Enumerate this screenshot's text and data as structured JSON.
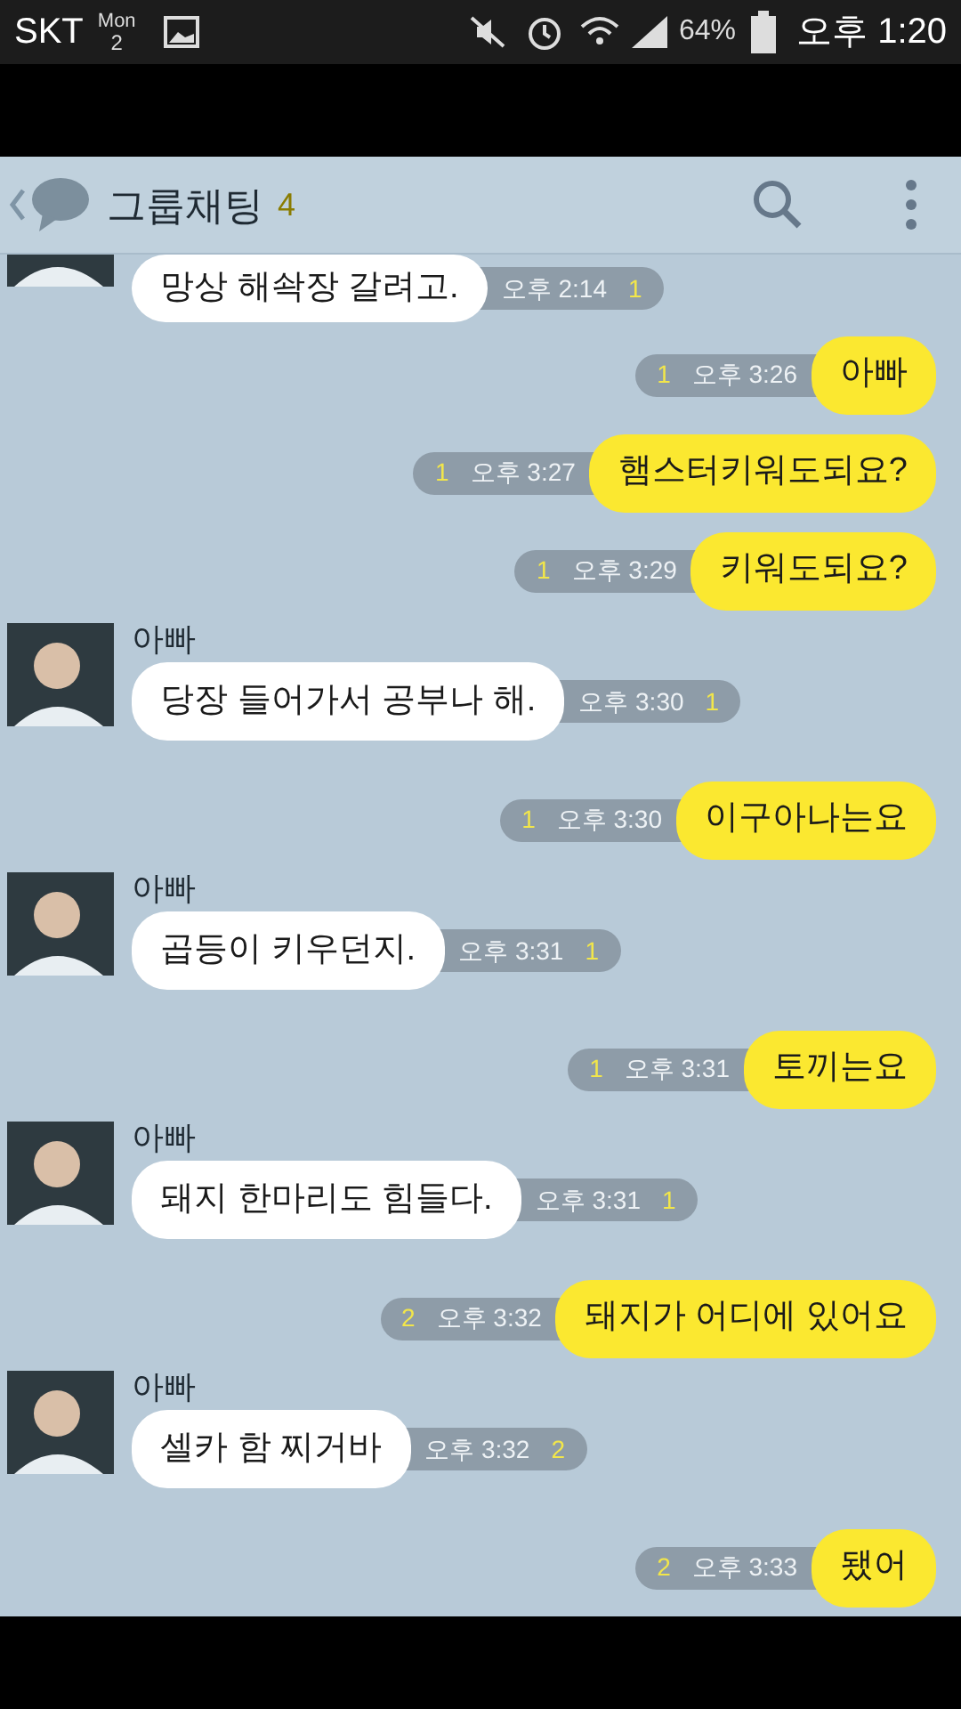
{
  "status_bar": {
    "carrier": "SKT",
    "day": "Mon",
    "date": "2",
    "battery": "64%",
    "time": "오후 1:20"
  },
  "header": {
    "title": "그룹채팅",
    "member_count": "4"
  },
  "messages": [
    {
      "kind": "in",
      "text": "망상 해솩장 갈려고.",
      "time": "오후 2:14",
      "unread": "1"
    },
    {
      "kind": "out",
      "text": "아빠",
      "time": "오후 3:26",
      "unread": "1"
    },
    {
      "kind": "out",
      "text": "햄스터키워도되요?",
      "time": "오후 3:27",
      "unread": "1"
    },
    {
      "kind": "out",
      "text": "키워도되요?",
      "time": "오후 3:29",
      "unread": "1"
    },
    {
      "kind": "in",
      "sender": "아빠",
      "text": "당장 들어가서 공부나 해.",
      "time": "오후 3:30",
      "unread": "1"
    },
    {
      "kind": "out",
      "text": "이구아나는요",
      "time": "오후 3:30",
      "unread": "1"
    },
    {
      "kind": "in",
      "sender": "아빠",
      "text": "곱등이 키우던지.",
      "time": "오후 3:31",
      "unread": "1"
    },
    {
      "kind": "out",
      "text": "토끼는요",
      "time": "오후 3:31",
      "unread": "1"
    },
    {
      "kind": "in",
      "sender": "아빠",
      "text": "돼지 한마리도 힘들다.",
      "time": "오후 3:31",
      "unread": "1"
    },
    {
      "kind": "out",
      "text": "돼지가 어디에 있어요",
      "time": "오후 3:32",
      "unread": "2"
    },
    {
      "kind": "in",
      "sender": "아빠",
      "text": "셀카 함 찌거바",
      "time": "오후 3:32",
      "unread": "2"
    },
    {
      "kind": "out",
      "text": "됐어",
      "time": "오후 3:33",
      "unread": "2"
    }
  ]
}
